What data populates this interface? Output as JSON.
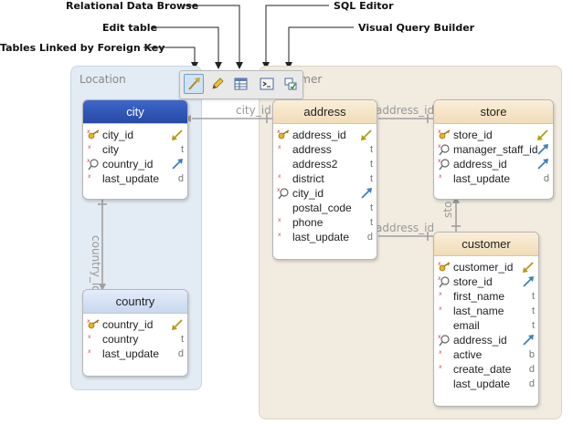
{
  "callouts": {
    "relational_data_browse": "Relational Data Browse",
    "edit_table": "Edit table",
    "tables_linked_by_foreign_key": "Tables Linked by Foreign Key",
    "sql_editor": "SQL Editor",
    "visual_query_builder": "Visual Query Builder"
  },
  "groups": {
    "location": "Location",
    "customer": "Customer"
  },
  "colors": {
    "location_group": "#e3ebf4",
    "customer_group": "#f1ebe0",
    "city_header": "#2c52b2",
    "tan_header": "#f4e4c6",
    "country_header": "#d4e0f4",
    "arrow": "#9a9a9a"
  },
  "entities": {
    "city": {
      "title": "city",
      "columns": [
        {
          "name": "city_id",
          "icon": "key-icon",
          "type": "",
          "type_icon": "fk-arrow-olive"
        },
        {
          "name": "city",
          "icon": "nullable-mark",
          "type": "t",
          "type_icon": ""
        },
        {
          "name": "country_id",
          "icon": "lookup-icon",
          "type": "",
          "type_icon": "fk-arrow-blue"
        },
        {
          "name": "last_update",
          "icon": "nullable-mark",
          "type": "d",
          "type_icon": ""
        }
      ]
    },
    "country": {
      "title": "country",
      "columns": [
        {
          "name": "country_id",
          "icon": "key-icon",
          "type": "",
          "type_icon": "fk-arrow-olive"
        },
        {
          "name": "country",
          "icon": "nullable-mark",
          "type": "t",
          "type_icon": ""
        },
        {
          "name": "last_update",
          "icon": "nullable-mark",
          "type": "d",
          "type_icon": ""
        }
      ]
    },
    "address": {
      "title": "address",
      "columns": [
        {
          "name": "address_id",
          "icon": "key-icon",
          "type": "",
          "type_icon": "fk-arrow-olive"
        },
        {
          "name": "address",
          "icon": "nullable-mark",
          "type": "t",
          "type_icon": ""
        },
        {
          "name": "address2",
          "icon": "",
          "type": "t",
          "type_icon": ""
        },
        {
          "name": "district",
          "icon": "nullable-mark",
          "type": "t",
          "type_icon": ""
        },
        {
          "name": "city_id",
          "icon": "lookup-icon",
          "type": "",
          "type_icon": "fk-arrow-blue"
        },
        {
          "name": "postal_code",
          "icon": "",
          "type": "t",
          "type_icon": ""
        },
        {
          "name": "phone",
          "icon": "nullable-mark",
          "type": "t",
          "type_icon": ""
        },
        {
          "name": "last_update",
          "icon": "nullable-mark",
          "type": "d",
          "type_icon": ""
        }
      ]
    },
    "store": {
      "title": "store",
      "columns": [
        {
          "name": "store_id",
          "icon": "key-icon",
          "type": "",
          "type_icon": "fk-arrow-olive"
        },
        {
          "name": "manager_staff_id",
          "icon": "lookup-icon",
          "type": "",
          "type_icon": "fk-arrow-blue"
        },
        {
          "name": "address_id",
          "icon": "lookup-icon",
          "type": "",
          "type_icon": "fk-arrow-blue"
        },
        {
          "name": "last_update",
          "icon": "nullable-mark",
          "type": "d",
          "type_icon": ""
        }
      ]
    },
    "customer": {
      "title": "customer",
      "columns": [
        {
          "name": "customer_id",
          "icon": "key-icon",
          "type": "",
          "type_icon": "fk-arrow-olive"
        },
        {
          "name": "store_id",
          "icon": "lookup-icon",
          "type": "",
          "type_icon": "fk-arrow-blue"
        },
        {
          "name": "first_name",
          "icon": "nullable-mark",
          "type": "t",
          "type_icon": ""
        },
        {
          "name": "last_name",
          "icon": "nullable-mark",
          "type": "t",
          "type_icon": ""
        },
        {
          "name": "email",
          "icon": "",
          "type": "t",
          "type_icon": ""
        },
        {
          "name": "address_id",
          "icon": "lookup-icon",
          "type": "",
          "type_icon": "fk-arrow-blue"
        },
        {
          "name": "active",
          "icon": "nullable-mark",
          "type": "b",
          "type_icon": ""
        },
        {
          "name": "create_date",
          "icon": "nullable-mark",
          "type": "d",
          "type_icon": ""
        },
        {
          "name": "last_update",
          "icon": "",
          "type": "d",
          "type_icon": ""
        }
      ]
    }
  },
  "edges": {
    "address_city": "city_id",
    "city_country": "country_id",
    "store_address": "address_id",
    "customer_address": "address_id",
    "customer_store": "sto"
  }
}
